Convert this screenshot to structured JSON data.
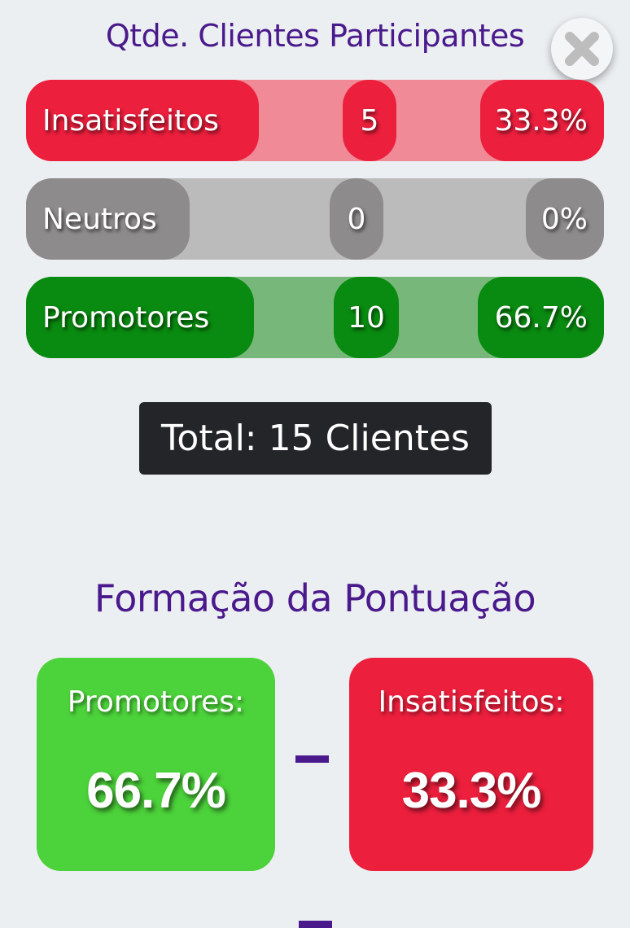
{
  "participants_section": {
    "title": "Qtde. Clientes Participantes",
    "rows": [
      {
        "label": "Insatisfeitos",
        "count": "5",
        "percent": "33.3%"
      },
      {
        "label": "Neutros",
        "count": "0",
        "percent": "0%"
      },
      {
        "label": "Promotores",
        "count": "10",
        "percent": "66.7%"
      }
    ],
    "total": "Total: 15 Clientes"
  },
  "score_section": {
    "title": "Formação da Pontuação",
    "promoters": {
      "label": "Promotores:",
      "value": "66.7%"
    },
    "detractors": {
      "label": "Insatisfeitos:",
      "value": "33.3%"
    },
    "operator": "−"
  },
  "colors": {
    "title": "#4a1a8c",
    "detractor": "#ec1f3d",
    "detractor_track": "#ef8a96",
    "neutral": "#8e8b8c",
    "neutral_track": "#bbbbbb",
    "promoter": "#098a10",
    "promoter_track": "#77b87a",
    "promoter_card": "#4cd23a",
    "total_bg": "#232528"
  },
  "icons": {
    "close": "close-icon"
  }
}
